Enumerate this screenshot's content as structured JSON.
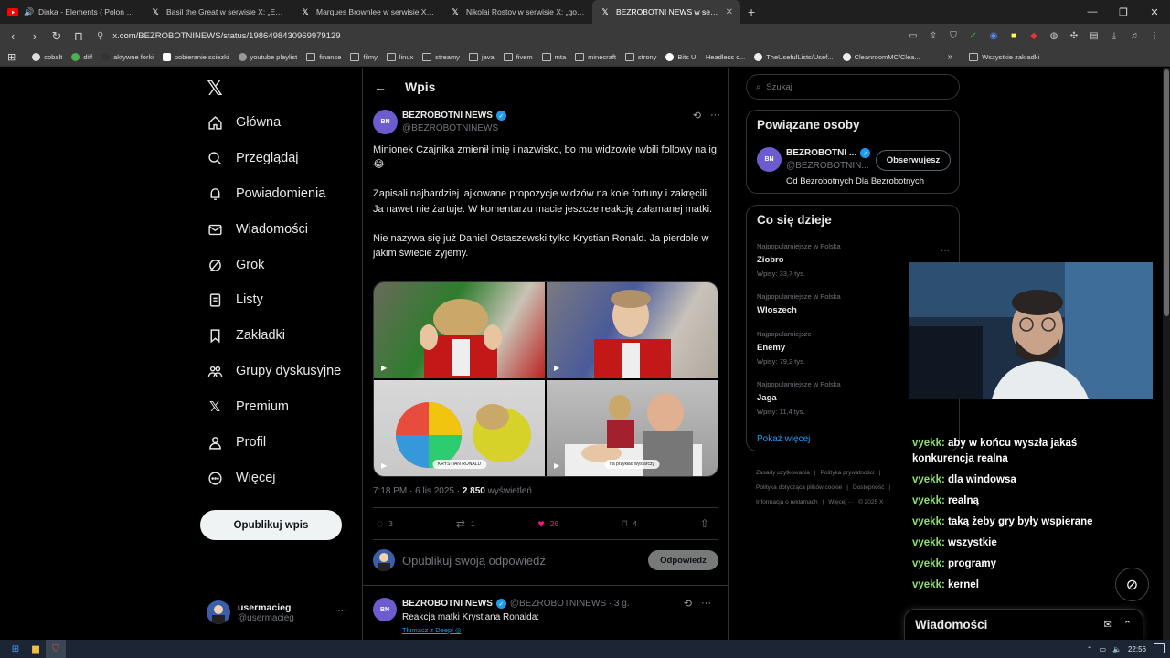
{
  "browser": {
    "tabs": [
      {
        "title": "Dinka - Elements ( Polon Remix )",
        "icon": "youtube-icon",
        "active": false
      },
      {
        "title": "Basil the Great w serwisie X: „EU Pres",
        "icon": "x-icon",
        "active": false
      },
      {
        "title": "Marques Brownlee w serwisie X: „You",
        "icon": "x-icon",
        "active": false
      },
      {
        "title": "Nikolai Rostov w serwisie X: „god ble",
        "icon": "x-icon",
        "active": false
      },
      {
        "title": "BEZROBOTNI NEWS w serwisie X",
        "icon": "x-icon",
        "active": true
      }
    ],
    "url": "x.com/BEZROBOTNINEWS/status/1986498430969979129",
    "bookmarks": [
      "cobalt",
      "diff",
      "aktywne forki",
      "pobieranie sciezki",
      "youtube playlist",
      "finanse",
      "filmy",
      "linux",
      "streamy",
      "java",
      "fivem",
      "mta",
      "minecraft",
      "strony",
      "Bits UI – Headless c...",
      "TheUsefulLists/Usef...",
      "CleanroomMC/Clea..."
    ],
    "all_bookmarks": "Wszystkie zakładki"
  },
  "nav": {
    "items": [
      {
        "label": "Główna",
        "icon": "home-icon"
      },
      {
        "label": "Przeglądaj",
        "icon": "search-icon"
      },
      {
        "label": "Powiadomienia",
        "icon": "bell-icon"
      },
      {
        "label": "Wiadomości",
        "icon": "mail-icon"
      },
      {
        "label": "Grok",
        "icon": "grok-icon"
      },
      {
        "label": "Listy",
        "icon": "list-icon"
      },
      {
        "label": "Zakładki",
        "icon": "bookmark-icon"
      },
      {
        "label": "Grupy dyskusyjne",
        "icon": "communities-icon"
      },
      {
        "label": "Premium",
        "icon": "x-premium-icon"
      },
      {
        "label": "Profil",
        "icon": "profile-icon"
      },
      {
        "label": "Więcej",
        "icon": "more-circle-icon"
      }
    ],
    "post_button": "Opublikuj wpis",
    "account": {
      "name": "usermacieg",
      "handle": "@usermacieg"
    }
  },
  "main": {
    "header": "Wpis",
    "tweet": {
      "name": "BEZROBOTNI NEWS",
      "handle": "@BEZROBOTNINEWS",
      "avatar_text": "BN",
      "paragraphs": [
        "Minionek Czajnika zmienił imię i nazwisko, bo mu widzowie wbili followy na ig 😂",
        "Zapisali najbardziej lajkowane propozycje widzów na kole fortuny i zakręcili. Ja nawet nie żartuje. W komentarzu macie jeszcze reakcję załamanej matki.",
        "Nie nazywa się już Daniel Ostaszewski tylko Krystian Ronald. Ja pierdole w jakim świecie żyjemy."
      ],
      "media_captions": [
        "",
        "",
        "KRYSTIAN RONALD",
        "na przykład wystarczy"
      ],
      "time": "7:18 PM · 6 lis 2025 · ",
      "views": "2 850",
      "views_label": " wyświetleń",
      "replies": "3",
      "reposts": "1",
      "likes": "26",
      "bookmarks": "4"
    },
    "reply_placeholder": "Opublikuj swoją odpowiedź",
    "reply_button": "Odpowiedz",
    "reply_tweet": {
      "name": "BEZROBOTNI NEWS",
      "handle_time": "@BEZROBOTNINEWS · 3 g.",
      "text": "Reakcja matki Krystiana Ronalda:",
      "translate": "Tłumacz z Deepl"
    }
  },
  "right": {
    "search_placeholder": "Szukaj",
    "related_title": "Powiązane osoby",
    "related": {
      "name": "BEZROBOTNI ...",
      "handle": "@BEZROBOTNIN...",
      "bio": "Od Bezrobotnych Dla Bezrobotnych",
      "follow": "Obserwujesz"
    },
    "trends_title": "Co się dzieje",
    "trends": [
      {
        "context": "Najpopularniejsze w Polska",
        "title": "Ziobro",
        "count": "Wpisy: 33,7 tys."
      },
      {
        "context": "Najpopularniejsze w Polska",
        "title": "Wloszech",
        "count": ""
      },
      {
        "context": "Najpopularniejsze",
        "title": "Enemy",
        "count": "Wpisy: 79,2 tys."
      },
      {
        "context": "Najpopularniejsze w Polska",
        "title": "Jaga",
        "count": "Wpisy: 11,4 tys."
      }
    ],
    "show_more": "Pokaż więcej",
    "footer": [
      "Zasady użytkowania",
      "|",
      "Polityka prywatności",
      "|",
      "Polityka dotycząca plików cookie",
      "|",
      "Dostępność",
      "|",
      "Informacja o reklamach",
      "|",
      "Więcej ···",
      "© 2025 X"
    ]
  },
  "chat": [
    {
      "user": "vyekk:",
      "text": "aby w końcu wyszła jakaś konkurencja realna"
    },
    {
      "user": "vyekk:",
      "text": "dla windowsa"
    },
    {
      "user": "vyekk:",
      "text": "realną"
    },
    {
      "user": "vyekk:",
      "text": "taką żeby gry były wspierane"
    },
    {
      "user": "vyekk:",
      "text": "wszystkie"
    },
    {
      "user": "vyekk:",
      "text": "programy"
    },
    {
      "user": "vyekk:",
      "text": "kernel"
    }
  ],
  "messages_dock": "Wiadomości",
  "taskbar": {
    "time": "22:56"
  }
}
